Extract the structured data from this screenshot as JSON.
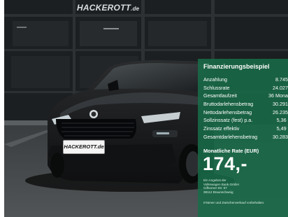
{
  "scene": {
    "description_alt": "Black compact SUV parked in front of a car dealership showroom",
    "dealer_sign_name": "HACKEROTT",
    "dealer_sign_domain": ".de",
    "plate_text": "HACKEROTT.de",
    "brand_emblem": "skoda-emblem"
  },
  "financing": {
    "title": "Finanzierungsbeispiel",
    "rows": [
      {
        "label": "Anzahlung",
        "value": "8.745 €"
      },
      {
        "label": "Schlussrate",
        "value": "24.027 €"
      },
      {
        "label": "Gesamtlaufzeit",
        "value": "36 Monate"
      },
      {
        "label": "Bruttodarlehensbetrag",
        "value": "30.291 €"
      },
      {
        "label": "Nettodarlehensbetrag",
        "value": "26.235 €"
      },
      {
        "label": "Sollzinssatz (fest) p.a.",
        "value": "5,36 %"
      },
      {
        "label": "Zinssatz effektiv",
        "value": "5,49 %"
      },
      {
        "label": "Gesamtdarlehensbetrag",
        "value": "30.283 €"
      }
    ],
    "rate_label": "Monatliche Rate (EUR)",
    "rate_value": "174,-",
    "offer_lines": [
      "Ein Angebot der",
      "Volkswagen Bank GmbH",
      "Gifhorner Str. 57",
      "38112 Braunschweig"
    ],
    "footnote": "Irrtümer und Zwischenverkauf vorbehalten."
  },
  "colors": {
    "panel_green": "#176c48",
    "car_black": "#151617",
    "showroom_dark": "#1b1d1e"
  }
}
